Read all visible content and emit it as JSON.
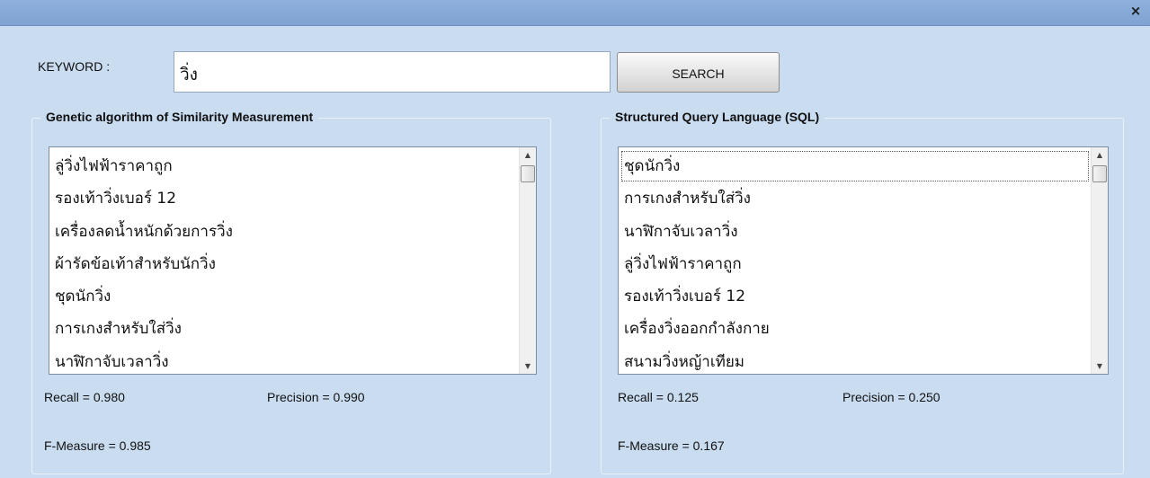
{
  "window": {
    "close_glyph": "×"
  },
  "search": {
    "label": "KEYWORD :",
    "value": "วิ่ง",
    "button_label": "SEARCH"
  },
  "ga_panel": {
    "title": "Genetic algorithm of Similarity Measurement",
    "items": [
      "ลู่วิ่งไฟฟ้าราคาถูก",
      "รองเท้าวิ่งเบอร์ 12",
      "เครื่องลดน้ำหนักด้วยการวิ่ง",
      "ผ้ารัดข้อเท้าสำหรับนักวิ่ง",
      "ชุดนักวิ่ง",
      "การเกงสำหรับใส่วิ่ง",
      "นาฬิกาจับเวลาวิ่ง"
    ],
    "recall": "Recall = 0.980",
    "precision": "Precision = 0.990",
    "f_measure": "F-Measure = 0.985"
  },
  "sql_panel": {
    "title": "Structured Query Language (SQL)",
    "items": [
      "ชุดนักวิ่ง",
      "การเกงสำหรับใส่วิ่ง",
      "นาฬิกาจับเวลาวิ่ง",
      "ลู่วิ่งไฟฟ้าราคาถูก",
      "รองเท้าวิ่งเบอร์ 12",
      "เครื่องวิ่งออกกำลังกาย",
      "สนามวิ่งหญ้าเทียม"
    ],
    "recall": "Recall = 0.125",
    "precision": "Precision = 0.250",
    "f_measure": "F-Measure = 0.167"
  }
}
